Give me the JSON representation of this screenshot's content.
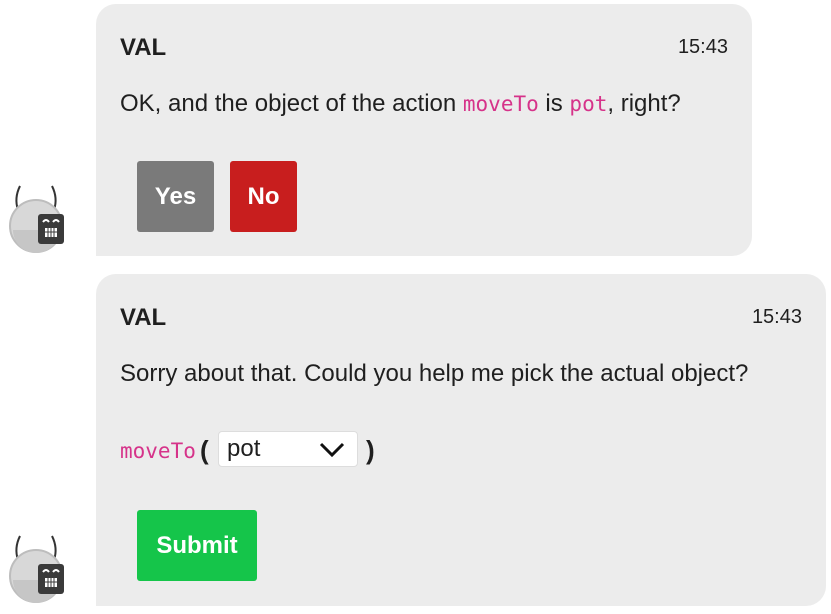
{
  "messages": [
    {
      "sender": "VAL",
      "time": "15:43",
      "text_prefix": "OK, and the object of the action ",
      "code_action": "moveTo",
      "text_mid": " is ",
      "code_object": "pot",
      "text_suffix": ", right?",
      "buttons": {
        "yes": "Yes",
        "no": "No"
      }
    },
    {
      "sender": "VAL",
      "time": "15:43",
      "text": "Sorry about that. Could you help me pick the actual object?",
      "code_action": "moveTo",
      "open_paren": "(",
      "select_value": "pot",
      "close_paren": ")",
      "submit_label": "Submit"
    }
  ],
  "colors": {
    "yes": "#7a7a7a",
    "no": "#c81e1e",
    "submit": "#15c54a",
    "code": "#d6338a"
  },
  "icons": {
    "avatar": "robot-avatar-icon",
    "dropdown": "chevron-down-icon"
  }
}
